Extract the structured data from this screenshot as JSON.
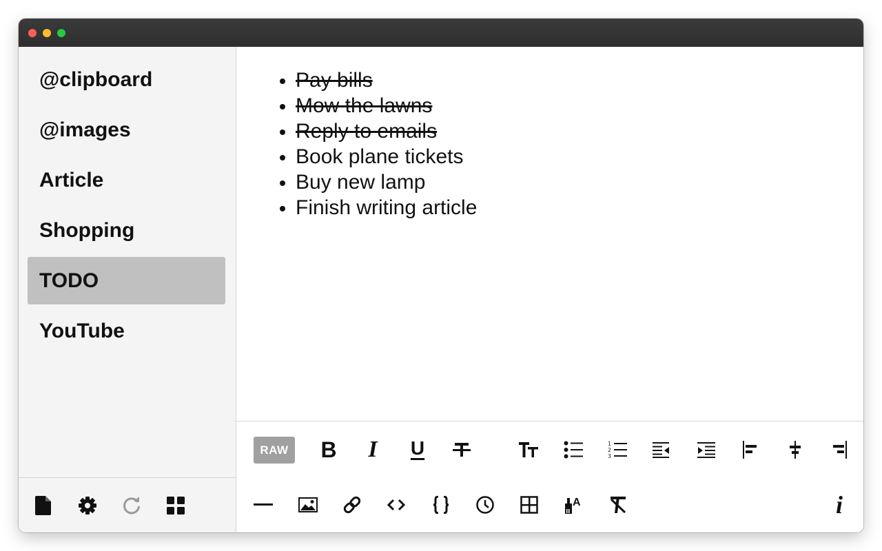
{
  "sidebar": {
    "items": [
      {
        "label": "@clipboard"
      },
      {
        "label": "@images"
      },
      {
        "label": "Article"
      },
      {
        "label": "Shopping"
      },
      {
        "label": "TODO"
      },
      {
        "label": "YouTube"
      }
    ],
    "selected": "TODO",
    "footer_icons": [
      "new-document-icon",
      "gear-icon",
      "refresh-icon",
      "grid-icon"
    ]
  },
  "editor": {
    "todos": [
      {
        "text": "Pay bills",
        "done": true
      },
      {
        "text": "Mow the lawns",
        "done": true
      },
      {
        "text": "Reply to emails",
        "done": true
      },
      {
        "text": "Book plane tickets",
        "done": false
      },
      {
        "text": "Buy new lamp",
        "done": false
      },
      {
        "text": "Finish writing article",
        "done": false
      }
    ]
  },
  "toolbar": {
    "raw_label": "RAW",
    "bold_label": "B",
    "italic_label": "I",
    "underline_label": "U",
    "info_label": "i"
  },
  "colors": {
    "titlebar": "#333333",
    "sidebar_bg": "#f4f4f4",
    "selected_bg": "#c0c0c0",
    "raw_bg": "#a0a0a0"
  }
}
